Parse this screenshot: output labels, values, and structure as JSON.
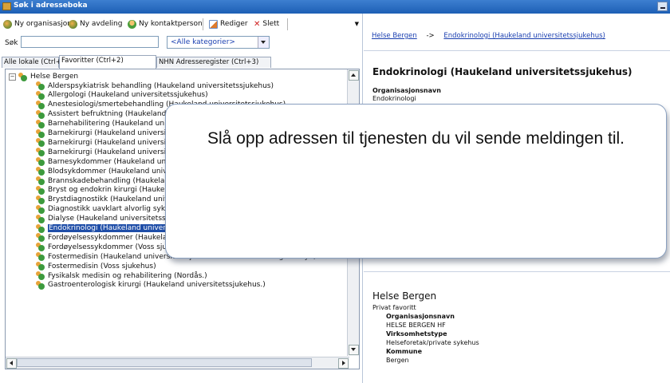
{
  "window": {
    "title": "Søk i adresseboka"
  },
  "toolbar": {
    "new_org": "Ny organisasjon",
    "new_dept": "Ny avdeling",
    "new_contact": "Ny kontaktperson",
    "edit": "Rediger",
    "delete": "Slett"
  },
  "search": {
    "label": "Søk",
    "value": "",
    "category": "<Alle kategorier>"
  },
  "tabs": [
    "Alle lokale (Ctrl+1)",
    "Favoritter (Ctrl+2)",
    "NHN Adresseregister (Ctrl+3)"
  ],
  "tree": {
    "root": "Helse Bergen",
    "items": [
      "Alderspsykiatrisk behandling (Haukeland universitetssjukehus)",
      "Allergologi (Haukeland universitetssjukehus)",
      "Anestesiologi/smertebehandling (Haukeland universitetssjukehus)",
      "Assistert befruktning (Haukeland universitetssjukehus)",
      "Barnehabilitering (Haukeland universitetssjukehus)",
      "Barnekirurgi (Haukeland universitetssjukehus)",
      "Barnekirurgi (Haukeland universitetssjukehus)",
      "Barnekirurgi (Haukeland universitetssjukehus)",
      "Barnesykdommer (Haukeland universitetssjukehus)",
      "Blodsykdommer (Haukeland universitetssjukehus)",
      "Brannskadebehandling (Haukeland universitetssjukehus)",
      "Bryst og endokrin kirurgi (Haukeland universitetssjukehus)",
      "Brystdiagnostikk (Haukeland universitetssjukehus)",
      "Diagnostikk uavklart alvorlig sykdom (Haukeland universitetssjukehus)",
      "Dialyse (Haukeland universitetssjukehus)",
      "Endokrinologi (Haukeland universitetssjukehus)",
      "Fordøyelsessykdommer (Haukeland universitetssjukehus)",
      "Fordøyelsessykdommer (Voss sjukehus)",
      "Fostermedisin (Haukeland universitetssjukehus. Fostermedisin og ultralyd)",
      "Fostermedisin (Voss sjukehus)",
      "Fysikalsk medisin og rehabilitering (Nordås.)",
      "Gastroenterologisk kirurgi (Haukeland universitetssjukehus.)"
    ],
    "selected_index": 15
  },
  "detail": {
    "breadcrumb_root": "Helse Bergen",
    "breadcrumb_arrow": "->",
    "breadcrumb_leaf": "Endokrinologi (Haukeland universitetssjukehus)",
    "title": "Endokrinologi (Haukeland universitetssjukehus)",
    "org_name_label": "Organisasjonsnavn",
    "org_name_value": "Endokrinologi"
  },
  "favorite_panel": {
    "title": "Helse Bergen",
    "subtitle": "Privat favoritt",
    "org_label": "Organisasjonsnavn",
    "org_value": "HELSE BERGEN HF",
    "type_label": "Virksomhetstype",
    "type_value": "Helseforetak/private sykehus",
    "municipality_label": "Kommune",
    "municipality_value": "Bergen"
  },
  "callout": {
    "text": "Slå opp adressen til tjenesten du vil sende meldingen til."
  }
}
